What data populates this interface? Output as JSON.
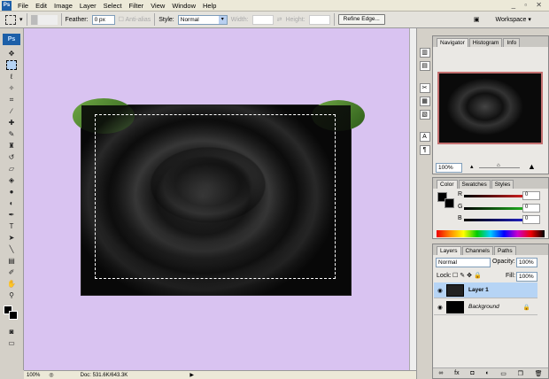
{
  "menu": [
    "File",
    "Edit",
    "Image",
    "Layer",
    "Select",
    "Filter",
    "View",
    "Window",
    "Help"
  ],
  "app_logo": "Ps",
  "window_controls": "_ ▫ ✕",
  "options": {
    "feather_label": "Feather:",
    "feather_value": "0 px",
    "antialias_label": "Anti-alias",
    "style_label": "Style:",
    "style_value": "Normal",
    "width_label": "Width:",
    "height_label": "Height:",
    "refine_edge": "Refine Edge...",
    "workspace": "Workspace ▾"
  },
  "status": {
    "zoom": "100%",
    "doc": "Doc: 531.6K/643.3K"
  },
  "navigator": {
    "tabs": [
      "Navigator",
      "Histogram",
      "Info"
    ],
    "zoom": "100%"
  },
  "color": {
    "tabs": [
      "Color",
      "Swatches",
      "Styles"
    ],
    "channels": [
      {
        "label": "R",
        "value": "0",
        "color": "#d02020"
      },
      {
        "label": "G",
        "value": "0",
        "color": "#20b020"
      },
      {
        "label": "B",
        "value": "0",
        "color": "#2020c0"
      }
    ]
  },
  "layers": {
    "tabs": [
      "Layers",
      "Channels",
      "Paths"
    ],
    "blend_mode": "Normal",
    "opacity_label": "Opacity:",
    "opacity": "100%",
    "lock_label": "Lock:",
    "fill_label": "Fill:",
    "fill": "100%",
    "items": [
      {
        "name": "Layer 1",
        "selected": true
      },
      {
        "name": "Background",
        "locked": true
      }
    ]
  },
  "colors": {
    "canvas_bg": "#d9c3f1",
    "selection": "#b6d4f5"
  }
}
